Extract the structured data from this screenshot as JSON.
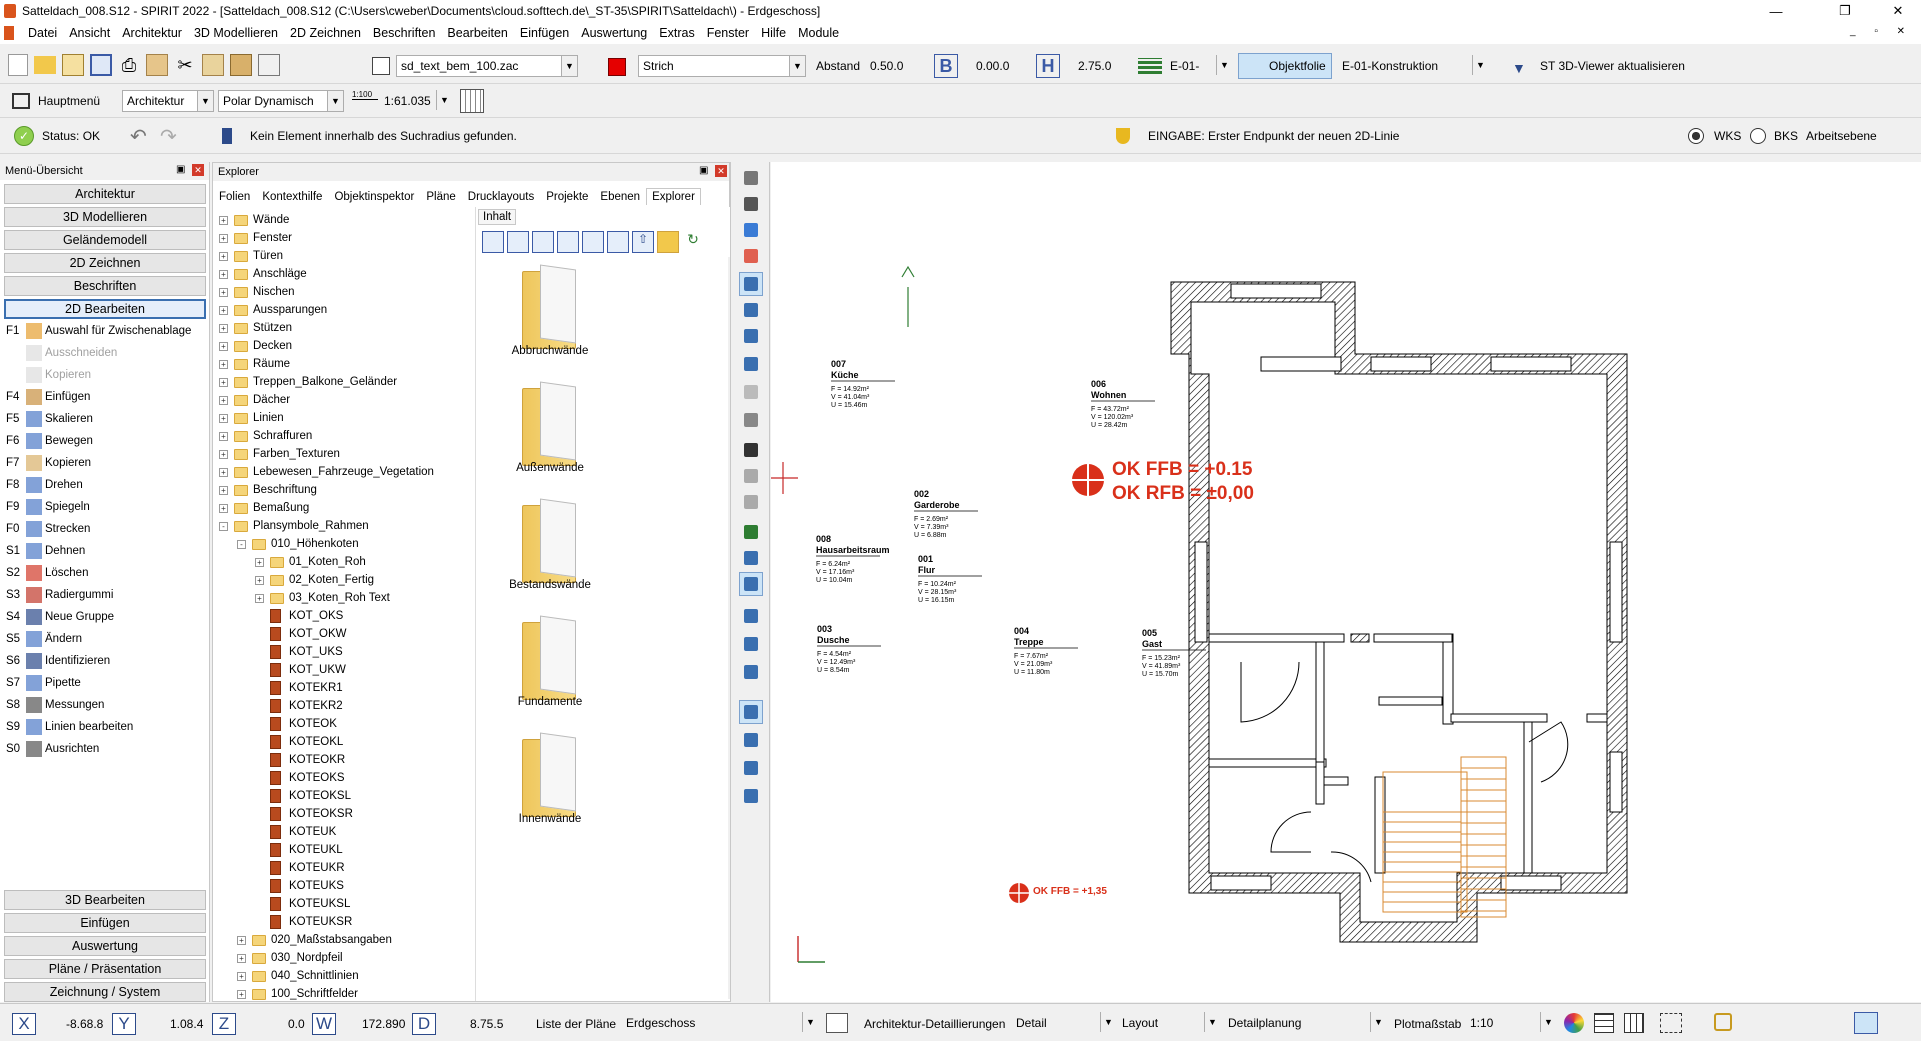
{
  "window": {
    "title": "Satteldach_008.S12 - SPIRIT 2022 - [Satteldach_008.S12 (C:\\Users\\cweber\\Documents\\cloud.softtech.de\\_ST-35\\SPIRIT\\Satteldach\\) - Erdgeschoss]"
  },
  "menu": [
    "Datei",
    "Ansicht",
    "Architektur",
    "3D Modellieren",
    "2D Zeichnen",
    "Beschriften",
    "Bearbeiten",
    "Einfügen",
    "Auswertung",
    "Extras",
    "Fenster",
    "Hilfe",
    "Module"
  ],
  "toolbar1": {
    "file_combo": "sd_text_bem_100.zac",
    "line_style": "Strich",
    "abstand_label": "Abstand",
    "abstand_value": "0.50.0",
    "b_value": "0.00.0",
    "h_value": "2.75.0",
    "layer_combo": "E-01-",
    "objektfolie_label": "Objektfolie",
    "folie_combo": "E-01-Konstruktion",
    "viewer_label": "ST 3D-Viewer aktualisieren",
    "b_letter": "B",
    "h_letter": "H"
  },
  "toolbar2": {
    "hauptmenu": "Hauptmenü",
    "arch_combo": "Architektur",
    "polar_combo": "Polar Dynamisch",
    "scale_icon": "1:100",
    "scale_combo": "1:61.035"
  },
  "toolbar3": {
    "status": "Status: OK",
    "message": "Kein Element innerhalb des Suchradius gefunden.",
    "eingabe": "EINGABE: Erster Endpunkt der neuen 2D-Linie",
    "wks": "WKS",
    "bks": "BKS",
    "arbeitsebene": "Arbeitsebene"
  },
  "left_panel": {
    "title": "Menü-Übersicht",
    "cats_top": [
      "Architektur",
      "3D Modellieren",
      "Geländemodell",
      "2D Zeichnen",
      "Beschriften",
      "2D Bearbeiten"
    ],
    "functions": [
      {
        "key": "F1",
        "label": "Auswahl für Zwischenablage",
        "icon": "clipboard-select-icon",
        "enabled": true
      },
      {
        "key": "",
        "label": "Ausschneiden",
        "icon": "scissors-icon",
        "enabled": false
      },
      {
        "key": "",
        "label": "Kopieren",
        "icon": "copy-icon",
        "enabled": false
      },
      {
        "key": "F4",
        "label": "Einfügen",
        "icon": "paste-icon",
        "enabled": true
      },
      {
        "key": "F5",
        "label": "Skalieren",
        "icon": "scale-icon",
        "enabled": true
      },
      {
        "key": "F6",
        "label": "Bewegen",
        "icon": "move-icon",
        "enabled": true
      },
      {
        "key": "F7",
        "label": "Kopieren",
        "icon": "copy-icon",
        "enabled": true
      },
      {
        "key": "F8",
        "label": "Drehen",
        "icon": "rotate-icon",
        "enabled": true
      },
      {
        "key": "F9",
        "label": "Spiegeln",
        "icon": "mirror-icon",
        "enabled": true
      },
      {
        "key": "F0",
        "label": "Strecken",
        "icon": "stretch-icon",
        "enabled": true
      },
      {
        "key": "S1",
        "label": "Dehnen",
        "icon": "extend-icon",
        "enabled": true
      },
      {
        "key": "S2",
        "label": "Löschen",
        "icon": "delete-icon",
        "enabled": true
      },
      {
        "key": "S3",
        "label": "Radiergummi",
        "icon": "eraser-icon",
        "enabled": true
      },
      {
        "key": "S4",
        "label": "Neue Gruppe",
        "icon": "group-icon",
        "enabled": true
      },
      {
        "key": "S5",
        "label": "Ändern",
        "icon": "modify-icon",
        "enabled": true
      },
      {
        "key": "S6",
        "label": "Identifizieren",
        "icon": "identify-icon",
        "enabled": true
      },
      {
        "key": "S7",
        "label": "Pipette",
        "icon": "pipette-icon",
        "enabled": true
      },
      {
        "key": "S8",
        "label": "Messungen",
        "icon": "measure-icon",
        "enabled": true
      },
      {
        "key": "S9",
        "label": "Linien bearbeiten",
        "icon": "line-edit-icon",
        "enabled": true
      },
      {
        "key": "S0",
        "label": "Ausrichten",
        "icon": "align-icon",
        "enabled": true
      }
    ],
    "cats_bottom": [
      "3D Bearbeiten",
      "Einfügen",
      "Auswertung",
      "Pläne / Präsentation",
      "Zeichnung / System"
    ]
  },
  "explorer": {
    "title": "Explorer",
    "tabs": [
      "Folien",
      "Kontexthilfe",
      "Objektinspektor",
      "Pläne",
      "Drucklayouts",
      "Projekte",
      "Ebenen",
      "Explorer"
    ],
    "tree": [
      {
        "label": "Wände",
        "level": 0,
        "type": "folder",
        "pm": "+"
      },
      {
        "label": "Fenster",
        "level": 0,
        "type": "folder",
        "pm": "+"
      },
      {
        "label": "Türen",
        "level": 0,
        "type": "folder",
        "pm": "+"
      },
      {
        "label": "Anschläge",
        "level": 0,
        "type": "folder",
        "pm": "+"
      },
      {
        "label": "Nischen",
        "level": 0,
        "type": "folder",
        "pm": "+"
      },
      {
        "label": "Aussparungen",
        "level": 0,
        "type": "folder",
        "pm": "+"
      },
      {
        "label": "Stützen",
        "level": 0,
        "type": "folder",
        "pm": "+"
      },
      {
        "label": "Decken",
        "level": 0,
        "type": "folder",
        "pm": "+"
      },
      {
        "label": "Räume",
        "level": 0,
        "type": "folder",
        "pm": "+"
      },
      {
        "label": "Treppen_Balkone_Geländer",
        "level": 0,
        "type": "folder",
        "pm": "+"
      },
      {
        "label": "Dächer",
        "level": 0,
        "type": "folder",
        "pm": "+"
      },
      {
        "label": "Linien",
        "level": 0,
        "type": "folder",
        "pm": "+"
      },
      {
        "label": "Schraffuren",
        "level": 0,
        "type": "folder",
        "pm": "+"
      },
      {
        "label": "Farben_Texturen",
        "level": 0,
        "type": "folder",
        "pm": "+"
      },
      {
        "label": "Lebewesen_Fahrzeuge_Vegetation",
        "level": 0,
        "type": "folder",
        "pm": "+"
      },
      {
        "label": "Beschriftung",
        "level": 0,
        "type": "folder",
        "pm": "+"
      },
      {
        "label": "Bemaßung",
        "level": 0,
        "type": "folder",
        "pm": "+"
      },
      {
        "label": "Plansymbole_Rahmen",
        "level": 0,
        "type": "folder",
        "pm": "-"
      },
      {
        "label": "010_Höhenkoten",
        "level": 1,
        "type": "folder",
        "pm": "-"
      },
      {
        "label": "01_Koten_Roh",
        "level": 2,
        "type": "folder",
        "pm": "+"
      },
      {
        "label": "02_Koten_Fertig",
        "level": 2,
        "type": "folder",
        "pm": "+"
      },
      {
        "label": "03_Koten_Roh Text",
        "level": 2,
        "type": "folder",
        "pm": "+"
      },
      {
        "label": "KOT_OKS",
        "level": 2,
        "type": "item",
        "pm": ""
      },
      {
        "label": "KOT_OKW",
        "level": 2,
        "type": "item",
        "pm": ""
      },
      {
        "label": "KOT_UKS",
        "level": 2,
        "type": "item",
        "pm": ""
      },
      {
        "label": "KOT_UKW",
        "level": 2,
        "type": "item",
        "pm": ""
      },
      {
        "label": "KOTEKR1",
        "level": 2,
        "type": "item",
        "pm": ""
      },
      {
        "label": "KOTEKR2",
        "level": 2,
        "type": "item",
        "pm": ""
      },
      {
        "label": "KOTEOK",
        "level": 2,
        "type": "item",
        "pm": ""
      },
      {
        "label": "KOTEOKL",
        "level": 2,
        "type": "item",
        "pm": ""
      },
      {
        "label": "KOTEOKR",
        "level": 2,
        "type": "item",
        "pm": ""
      },
      {
        "label": "KOTEOKS",
        "level": 2,
        "type": "item",
        "pm": ""
      },
      {
        "label": "KOTEOKSL",
        "level": 2,
        "type": "item",
        "pm": ""
      },
      {
        "label": "KOTEOKSR",
        "level": 2,
        "type": "item",
        "pm": ""
      },
      {
        "label": "KOTEUK",
        "level": 2,
        "type": "item",
        "pm": ""
      },
      {
        "label": "KOTEUKL",
        "level": 2,
        "type": "item",
        "pm": ""
      },
      {
        "label": "KOTEUKR",
        "level": 2,
        "type": "item",
        "pm": ""
      },
      {
        "label": "KOTEUKS",
        "level": 2,
        "type": "item",
        "pm": ""
      },
      {
        "label": "KOTEUKSL",
        "level": 2,
        "type": "item",
        "pm": ""
      },
      {
        "label": "KOTEUKSR",
        "level": 2,
        "type": "item",
        "pm": ""
      },
      {
        "label": "020_Maßstabsangaben",
        "level": 1,
        "type": "folder",
        "pm": "+"
      },
      {
        "label": "030_Nordpfeil",
        "level": 1,
        "type": "folder",
        "pm": "+"
      },
      {
        "label": "040_Schnittlinien",
        "level": 1,
        "type": "folder",
        "pm": "+"
      },
      {
        "label": "100_Schriftfelder",
        "level": 1,
        "type": "folder",
        "pm": "+"
      }
    ],
    "content_tab": "Inhalt",
    "content_items": [
      "Abbruchwände",
      "Außenwände",
      "Bestandswände",
      "Fundamente",
      "Innenwände"
    ]
  },
  "drawing": {
    "rooms": [
      {
        "num": "007",
        "name": "Küche",
        "f": "F = 14.92m²",
        "v": "V = 41.04m³",
        "u": "U = 15.46m"
      },
      {
        "num": "006",
        "name": "Wohnen",
        "f": "F = 43.72m²",
        "v": "V = 120.02m³",
        "u": "U = 28.42m"
      },
      {
        "num": "002",
        "name": "Garderobe",
        "f": "F = 2.69m²",
        "v": "V = 7.39m³",
        "u": "U = 6.88m"
      },
      {
        "num": "008",
        "name": "Hausarbeitsraum",
        "f": "F = 6.24m²",
        "v": "V = 17.16m³",
        "u": "U = 10.04m"
      },
      {
        "num": "001",
        "name": "Flur",
        "f": "F = 10.24m²",
        "v": "V = 28.15m³",
        "u": "U = 16.15m"
      },
      {
        "num": "003",
        "name": "Dusche",
        "f": "F = 4.54m²",
        "v": "V = 12.49m³",
        "u": "U = 8.54m"
      },
      {
        "num": "004",
        "name": "Treppe",
        "f": "F = 7.67m²",
        "v": "V = 21.09m³",
        "u": "U = 11.80m"
      },
      {
        "num": "005",
        "name": "Gast",
        "f": "F = 15.23m²",
        "v": "V = 41.89m³",
        "u": "U = 15.70m"
      }
    ],
    "level1": "OK FFB = +0.15",
    "level2": "OK RFB = ±0,00",
    "level_small": "OK FFB = +1,35"
  },
  "statusbar": {
    "x_label": "X",
    "x_val": "-8.68.8",
    "y_label": "Y",
    "y_val": "1.08.4",
    "z_label": "Z",
    "z_val": "0.0",
    "w_label": "W",
    "w_val": "172.890",
    "d_label": "D",
    "d_val": "8.75.5",
    "plan_list": "Liste der Pläne",
    "plan_value": "Erdgeschoss",
    "detail": "Architektur-Detaillierungen",
    "detail_value": "Detail",
    "layout": "Layout",
    "detailplanung": "Detailplanung",
    "plotmass": "Plotmaßstab",
    "plot_value": "1:10"
  },
  "colors": {
    "accent": "#3a6fb0",
    "red": "#e53b1c",
    "level_red": "#d9301a"
  }
}
